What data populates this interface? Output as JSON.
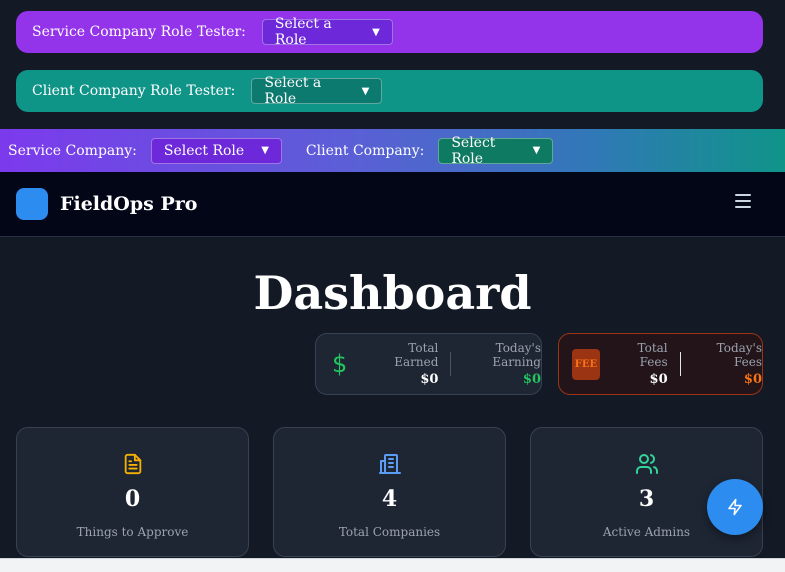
{
  "service_tester": {
    "label": "Service Company Role Tester:",
    "select_value": "Select a Role"
  },
  "client_tester": {
    "label": "Client Company Role Tester:",
    "select_value": "Select a Role"
  },
  "role_strip": {
    "service_label": "Service Company:",
    "service_select": "Select Role",
    "client_label": "Client Company:",
    "client_select": "Select Role"
  },
  "nav": {
    "brand": "FieldOps Pro",
    "menu_icon": "hamburger-menu-icon"
  },
  "page_title": "Dashboard",
  "earnings": {
    "icon": "dollar-icon",
    "total_label": "Total Earned",
    "total_value": "$0",
    "today_label": "Today's Earning",
    "today_value": "$0"
  },
  "fees": {
    "icon_text": "FEE",
    "total_label": "Total Fees",
    "total_value": "$0",
    "today_label": "Today's Fees",
    "today_value": "$0"
  },
  "cards": [
    {
      "icon": "document-icon",
      "value": "0",
      "label": "Things to Approve",
      "color": "#f5b100"
    },
    {
      "icon": "building-icon",
      "value": "4",
      "label": "Total Companies",
      "color": "#5b9cf5"
    },
    {
      "icon": "users-icon",
      "value": "3",
      "label": "Active Admins",
      "color": "#34d399"
    }
  ],
  "fab_icon": "lightning-icon",
  "colors": {
    "purple": "#9333ea",
    "teal": "#0f9488",
    "blue": "#2d8cf0",
    "green": "#22c55e",
    "orange": "#f97316"
  }
}
